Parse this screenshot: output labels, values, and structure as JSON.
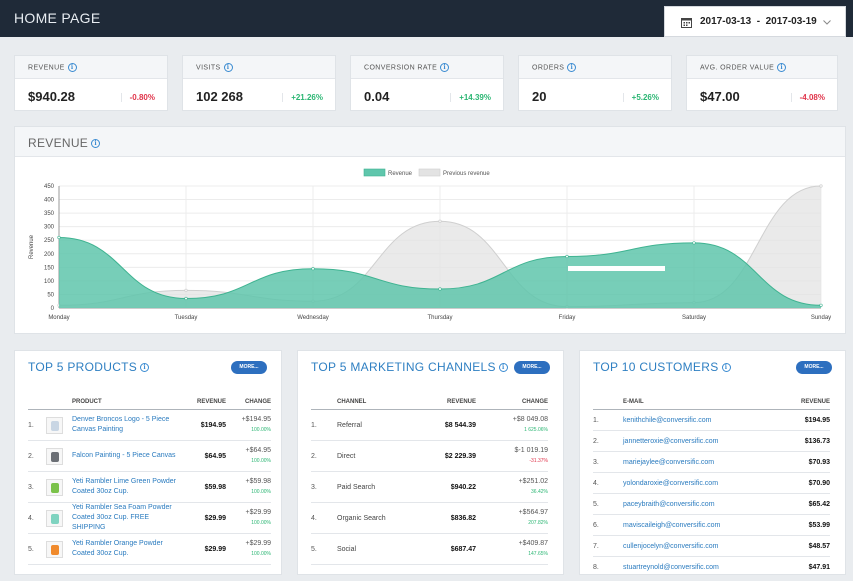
{
  "header": {
    "title": "HOME PAGE",
    "date_range": "2017-03-13  -  2017-03-19"
  },
  "kpis": [
    {
      "label": "REVENUE",
      "value": "$940.28",
      "change": "-0.80%",
      "trend": "neg"
    },
    {
      "label": "VISITS",
      "value": "102 268",
      "change": "+21.26%",
      "trend": "pos"
    },
    {
      "label": "CONVERSION RATE",
      "value": "0.04",
      "change": "+14.39%",
      "trend": "pos"
    },
    {
      "label": "ORDERS",
      "value": "20",
      "change": "+5.26%",
      "trend": "pos"
    },
    {
      "label": "AVG. ORDER VALUE",
      "value": "$47.00",
      "change": "-4.08%",
      "trend": "neg"
    }
  ],
  "revenue_section": {
    "title": "REVENUE"
  },
  "chart_data": {
    "type": "area",
    "categories": [
      "Monday",
      "Tuesday",
      "Wednesday",
      "Thursday",
      "Friday",
      "Saturday",
      "Sunday"
    ],
    "series": [
      {
        "name": "Revenue",
        "values": [
          260,
          35,
          145,
          70,
          190,
          240,
          10
        ],
        "color": "#5fc6ac"
      },
      {
        "name": "Previous revenue",
        "values": [
          10,
          65,
          25,
          320,
          5,
          20,
          450
        ],
        "color": "#dcdcdc"
      }
    ],
    "ylabel": "Revenue",
    "ylim": [
      0,
      450
    ],
    "yticks": [
      "0",
      "50",
      "100",
      "150",
      "200",
      "250",
      "300",
      "350",
      "400",
      "450"
    ],
    "legend": "top-center",
    "grid": true
  },
  "products": {
    "title": "TOP 5 PRODUCTS",
    "more": "MORE...",
    "headers": [
      "PRODUCT",
      "REVENUE",
      "CHANGE"
    ],
    "rows": [
      {
        "idx": "1.",
        "name": "Denver Broncos Logo - 5 Piece Canvas Painting",
        "revenue": "$194.95",
        "change": "+$194.95",
        "pct": "100.00%",
        "thumb": "#c9d6e4"
      },
      {
        "idx": "2.",
        "name": "Falcon Painting - 5 Piece Canvas",
        "revenue": "$64.95",
        "change": "+$64.95",
        "pct": "100.00%",
        "thumb": "#6b6f75"
      },
      {
        "idx": "3.",
        "name": "Yeti Rambler Lime Green Powder Coated 30oz Cup.",
        "revenue": "$59.98",
        "change": "+$59.98",
        "pct": "100.00%",
        "thumb": "#7bc24a"
      },
      {
        "idx": "4.",
        "name": "Yeti Rambler Sea Foam Powder Coated 30oz Cup. FREE SHIPPING",
        "revenue": "$29.99",
        "change": "+$29.99",
        "pct": "100.00%",
        "thumb": "#7fd3c0"
      },
      {
        "idx": "5.",
        "name": "Yeti Rambler Orange Powder Coated 30oz Cup.",
        "revenue": "$29.99",
        "change": "+$29.99",
        "pct": "100.00%",
        "thumb": "#f08a2c"
      }
    ]
  },
  "channels": {
    "title": "TOP 5 MARKETING CHANNELS",
    "more": "MORE...",
    "headers": [
      "CHANNEL",
      "REVENUE",
      "CHANGE"
    ],
    "rows": [
      {
        "idx": "1.",
        "name": "Referral",
        "revenue": "$8 544.39",
        "change": "+$8 049.08",
        "pct": "1 625.06%",
        "trend": "pos"
      },
      {
        "idx": "2.",
        "name": "Direct",
        "revenue": "$2 229.39",
        "change": "$-1 019.19",
        "pct": "-31.37%",
        "trend": "neg"
      },
      {
        "idx": "3.",
        "name": "Paid Search",
        "revenue": "$940.22",
        "change": "+$251.02",
        "pct": "36.42%",
        "trend": "pos"
      },
      {
        "idx": "4.",
        "name": "Organic Search",
        "revenue": "$836.82",
        "change": "+$564.97",
        "pct": "207.82%",
        "trend": "pos"
      },
      {
        "idx": "5.",
        "name": "Social",
        "revenue": "$687.47",
        "change": "+$409.87",
        "pct": "147.65%",
        "trend": "pos"
      }
    ]
  },
  "customers": {
    "title": "TOP 10 CUSTOMERS",
    "more": "MORE...",
    "headers": [
      "E-MAIL",
      "REVENUE"
    ],
    "rows": [
      {
        "idx": "1.",
        "email": "kenithchile@conversific.com",
        "revenue": "$194.95"
      },
      {
        "idx": "2.",
        "email": "jannetteroxie@conversific.com",
        "revenue": "$136.73"
      },
      {
        "idx": "3.",
        "email": "mariejaylee@conversific.com",
        "revenue": "$70.93"
      },
      {
        "idx": "4.",
        "email": "yolondaroxie@conversific.com",
        "revenue": "$70.90"
      },
      {
        "idx": "5.",
        "email": "paceybraith@conversific.com",
        "revenue": "$65.42"
      },
      {
        "idx": "6.",
        "email": "maviscaileigh@conversific.com",
        "revenue": "$53.99"
      },
      {
        "idx": "7.",
        "email": "cullenjocelyn@conversific.com",
        "revenue": "$48.57"
      },
      {
        "idx": "8.",
        "email": "stuartreynold@conversific.com",
        "revenue": "$47.91"
      }
    ]
  }
}
